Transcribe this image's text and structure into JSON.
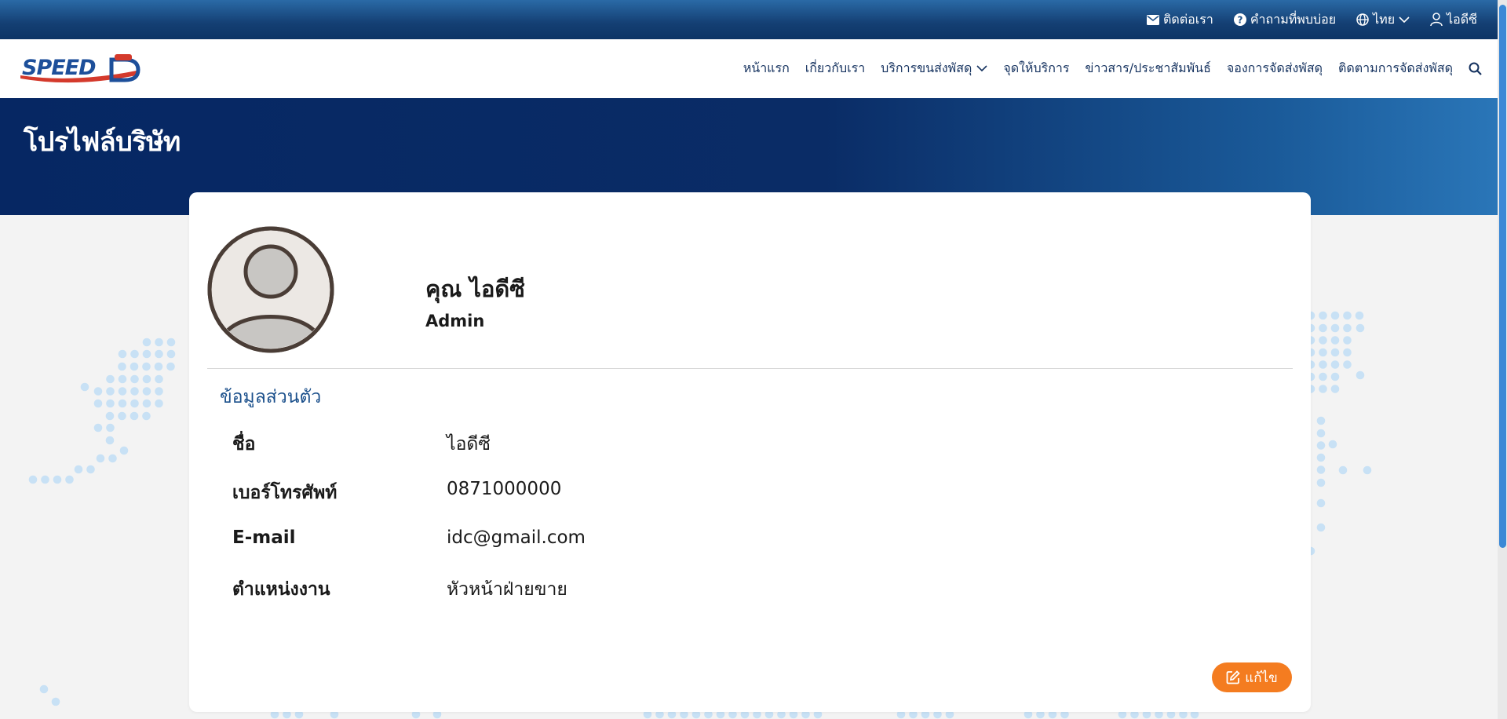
{
  "topbar": {
    "contact": "ติดต่อเรา",
    "faq": "คำถามที่พบบ่อย",
    "language": "ไทย",
    "user": "ไอดีซี"
  },
  "header": {
    "logo_text": "SPEED-D",
    "nav": [
      {
        "label": "หน้าแรก"
      },
      {
        "label": "เกี่ยวกับเรา"
      },
      {
        "label": "บริการขนส่งพัสดุ"
      },
      {
        "label": "จุดให้บริการ"
      },
      {
        "label": "ข่าวสาร/ประชาสัมพันธ์"
      },
      {
        "label": "จองการจัดส่งพัสดุ"
      },
      {
        "label": "ติดตามการจัดส่งพัสดุ"
      }
    ]
  },
  "hero": {
    "title": "โปรไฟล์บริษัท"
  },
  "profile": {
    "name": "คุณ ไอดีซี",
    "role": "Admin",
    "section_title": "ข้อมูลส่วนตัว",
    "rows": [
      {
        "label": "ชื่อ",
        "value": "ไอดีซี"
      },
      {
        "label": "เบอร์โทรศัพท์",
        "value": "0871000000"
      },
      {
        "label": "E-mail",
        "value": "idc@gmail.com"
      },
      {
        "label": "ตำแหน่งงาน",
        "value": "หัวหน้าฝ่ายขาย"
      }
    ],
    "edit_label": "แก้ไข"
  },
  "colors": {
    "primary_dark": "#062763",
    "accent_orange": "#f47c20",
    "section_blue": "#1a4f8b",
    "dot_blue": "#c8e1f5"
  }
}
